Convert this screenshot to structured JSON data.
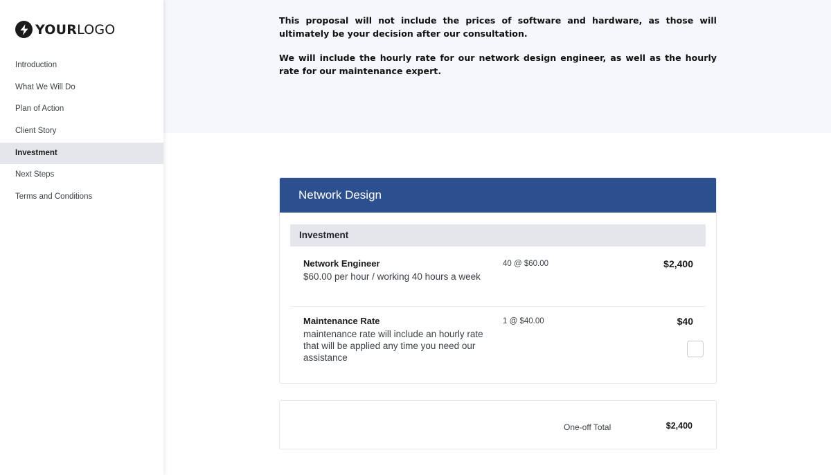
{
  "logo": {
    "bold": "YOUR",
    "light": "LOGO",
    "icon": "lightning-bolt-icon"
  },
  "sidebar": {
    "items": [
      {
        "label": "Introduction"
      },
      {
        "label": "What We Will Do"
      },
      {
        "label": "Plan of Action"
      },
      {
        "label": "Client Story"
      },
      {
        "label": "Investment",
        "active": true
      },
      {
        "label": "Next Steps"
      },
      {
        "label": "Terms and Conditions"
      }
    ]
  },
  "intro": {
    "paragraph1": "This proposal will not include the prices of software and hardware, as those will ultimately be your decision after our consultation.",
    "paragraph2": "We will include the hourly rate for our network design engineer, as well as the hourly rate for our maintenance expert."
  },
  "card": {
    "header": "Network Design",
    "section_title": "Investment",
    "items": [
      {
        "title": "Network Engineer",
        "description": "$60.00 per hour / working 40 hours a week",
        "quantity": "40 @ $60.00",
        "price": "$2,400"
      },
      {
        "title": "Maintenance Rate",
        "description": "maintenance rate will include an hourly rate that will be applied any time you need our assistance",
        "quantity": "1 @ $40.00",
        "price": "$40",
        "optional_checked": false
      }
    ]
  },
  "total": {
    "label": "One-off Total",
    "value": "$2,400"
  },
  "colors": {
    "header_blue": "#2c4f8e",
    "section_grey": "#e4e6ec",
    "top_band": "#f5f7fc"
  }
}
